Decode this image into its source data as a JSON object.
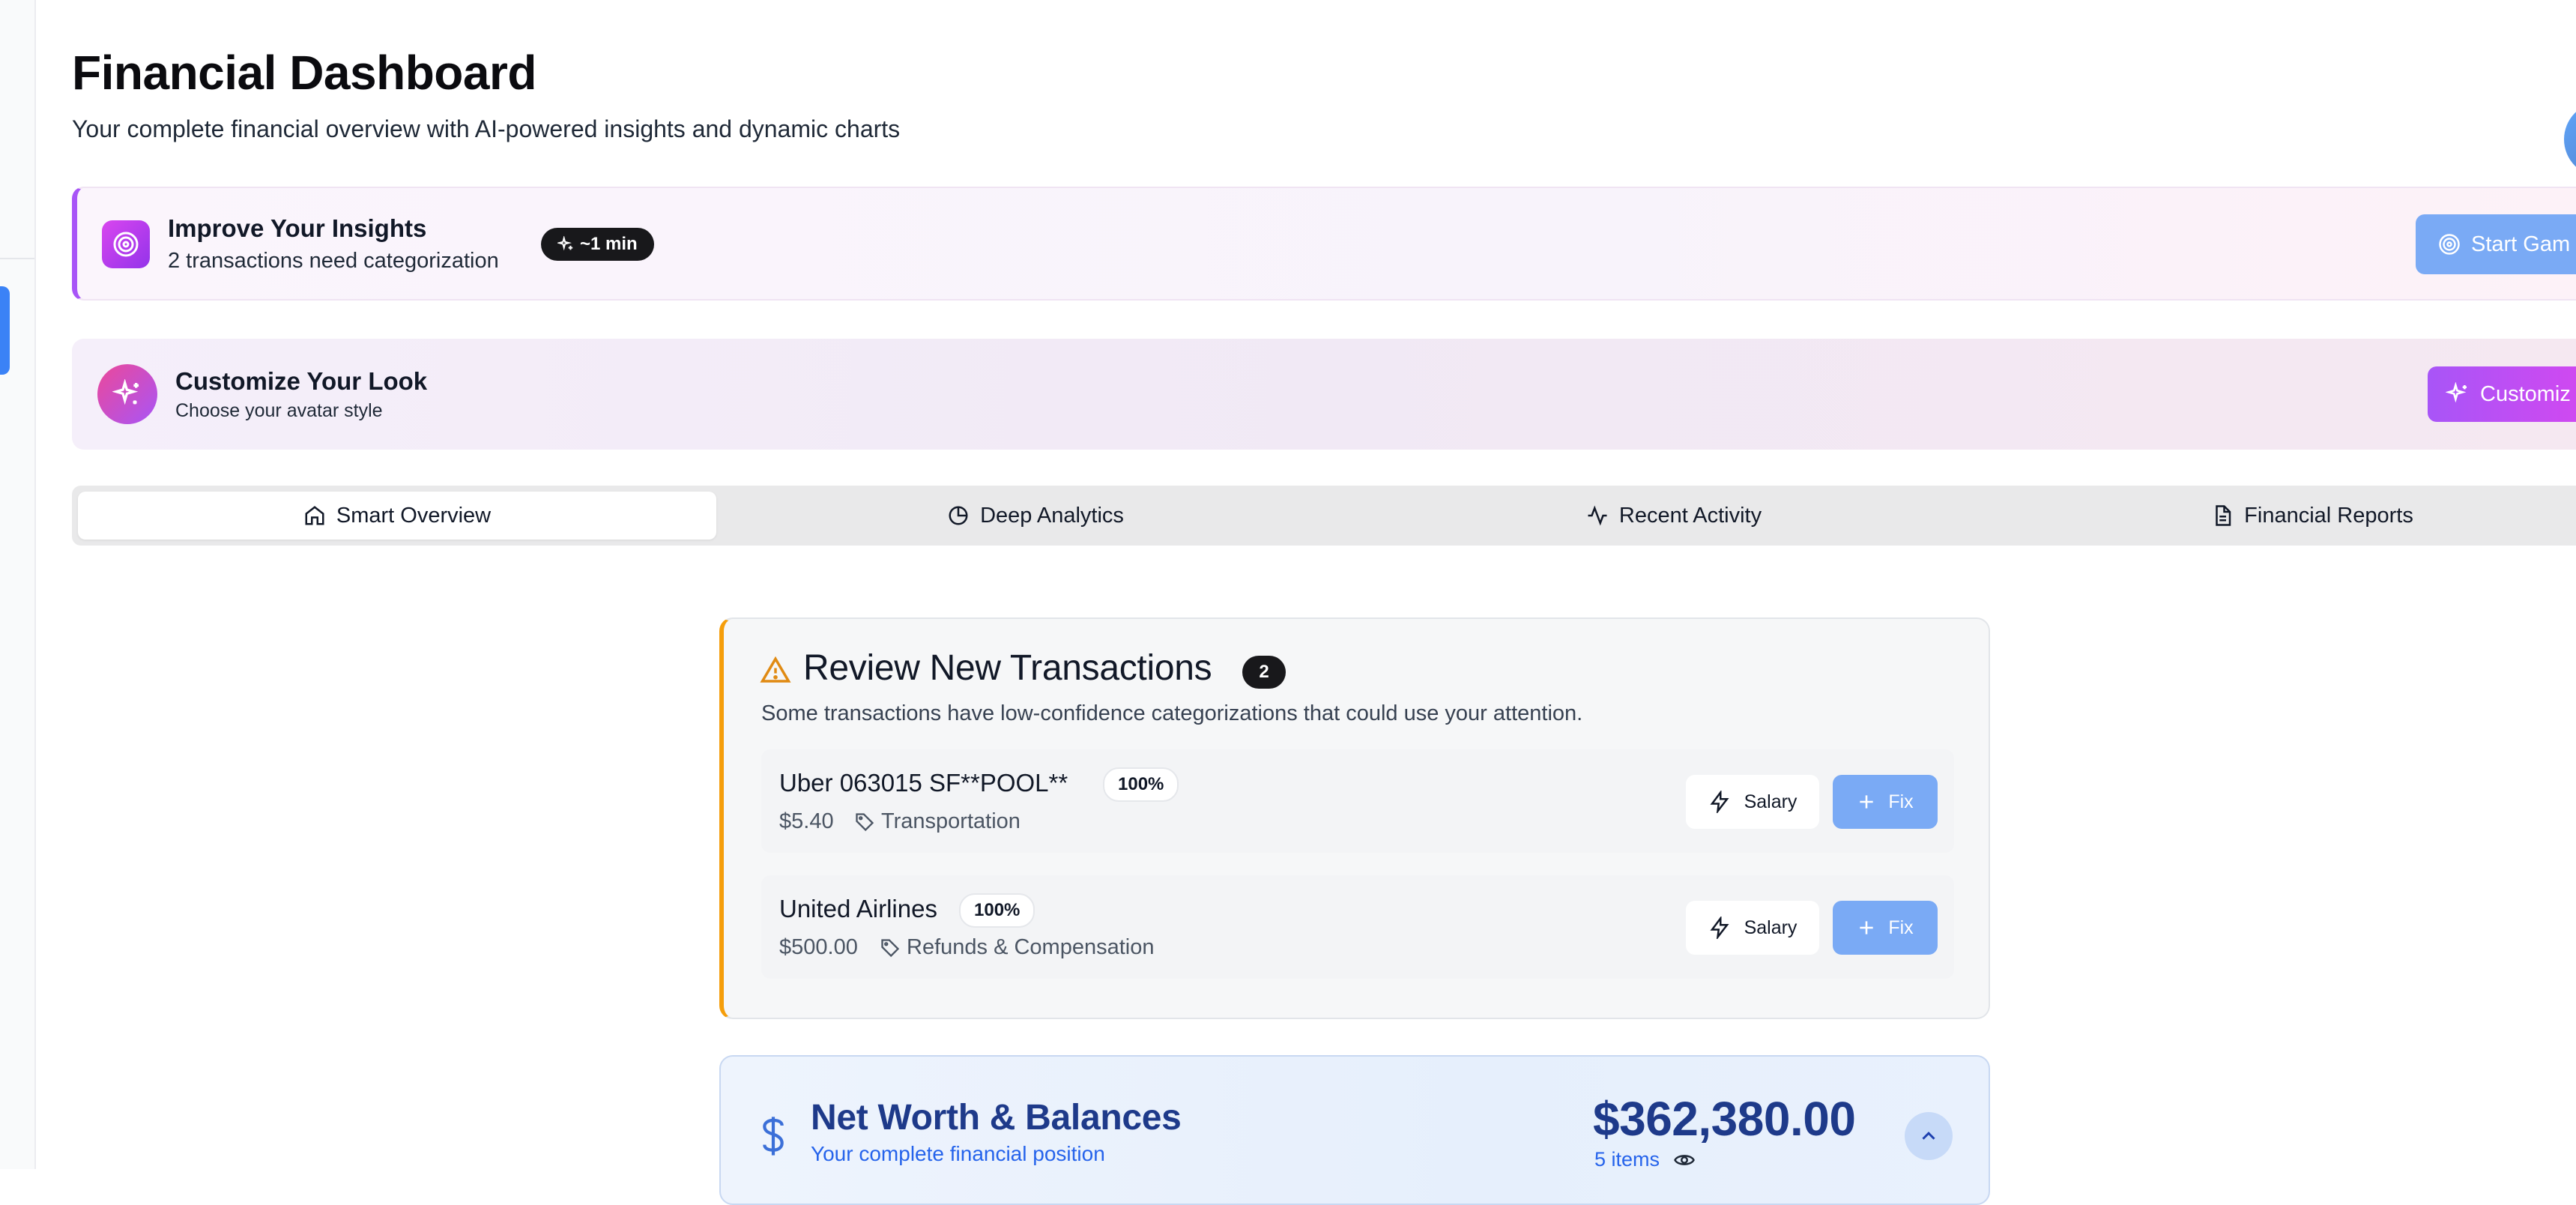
{
  "header": {
    "title": "Financial Dashboard",
    "subtitle": "Your complete financial overview with AI-powered insights and dynamic charts"
  },
  "insights_banner": {
    "title": "Improve Your Insights",
    "subtitle": "2 transactions need categorization",
    "time_estimate": "~1 min",
    "button_label": "Start Gam"
  },
  "customize_banner": {
    "title": "Customize Your Look",
    "subtitle": "Choose your avatar style",
    "button_label": "Customiz"
  },
  "tabs": [
    {
      "label": "Smart Overview",
      "icon": "home-icon",
      "active": true
    },
    {
      "label": "Deep Analytics",
      "icon": "pie-chart-icon",
      "active": false
    },
    {
      "label": "Recent Activity",
      "icon": "activity-icon",
      "active": false
    },
    {
      "label": "Financial Reports",
      "icon": "document-icon",
      "active": false
    }
  ],
  "review": {
    "title": "Review New Transactions",
    "count": "2",
    "description": "Some transactions have low-confidence categorizations that could use your attention.",
    "transactions": [
      {
        "name": "Uber 063015 SF**POOL**",
        "confidence": "100%",
        "amount": "$5.40",
        "category": "Transportation",
        "suggest_label": "Salary",
        "fix_label": "Fix"
      },
      {
        "name": "United Airlines",
        "confidence": "100%",
        "amount": "$500.00",
        "category": "Refunds & Compensation",
        "suggest_label": "Salary",
        "fix_label": "Fix"
      }
    ]
  },
  "net_worth": {
    "title": "Net Worth & Balances",
    "subtitle": "Your complete financial position",
    "amount": "$362,380.00",
    "items_label": "5 items"
  },
  "colors": {
    "accent_blue": "#7aaaf5",
    "purple": "#a855f7",
    "warning_orange": "#f59e0b",
    "navy": "#1e3a8a"
  }
}
